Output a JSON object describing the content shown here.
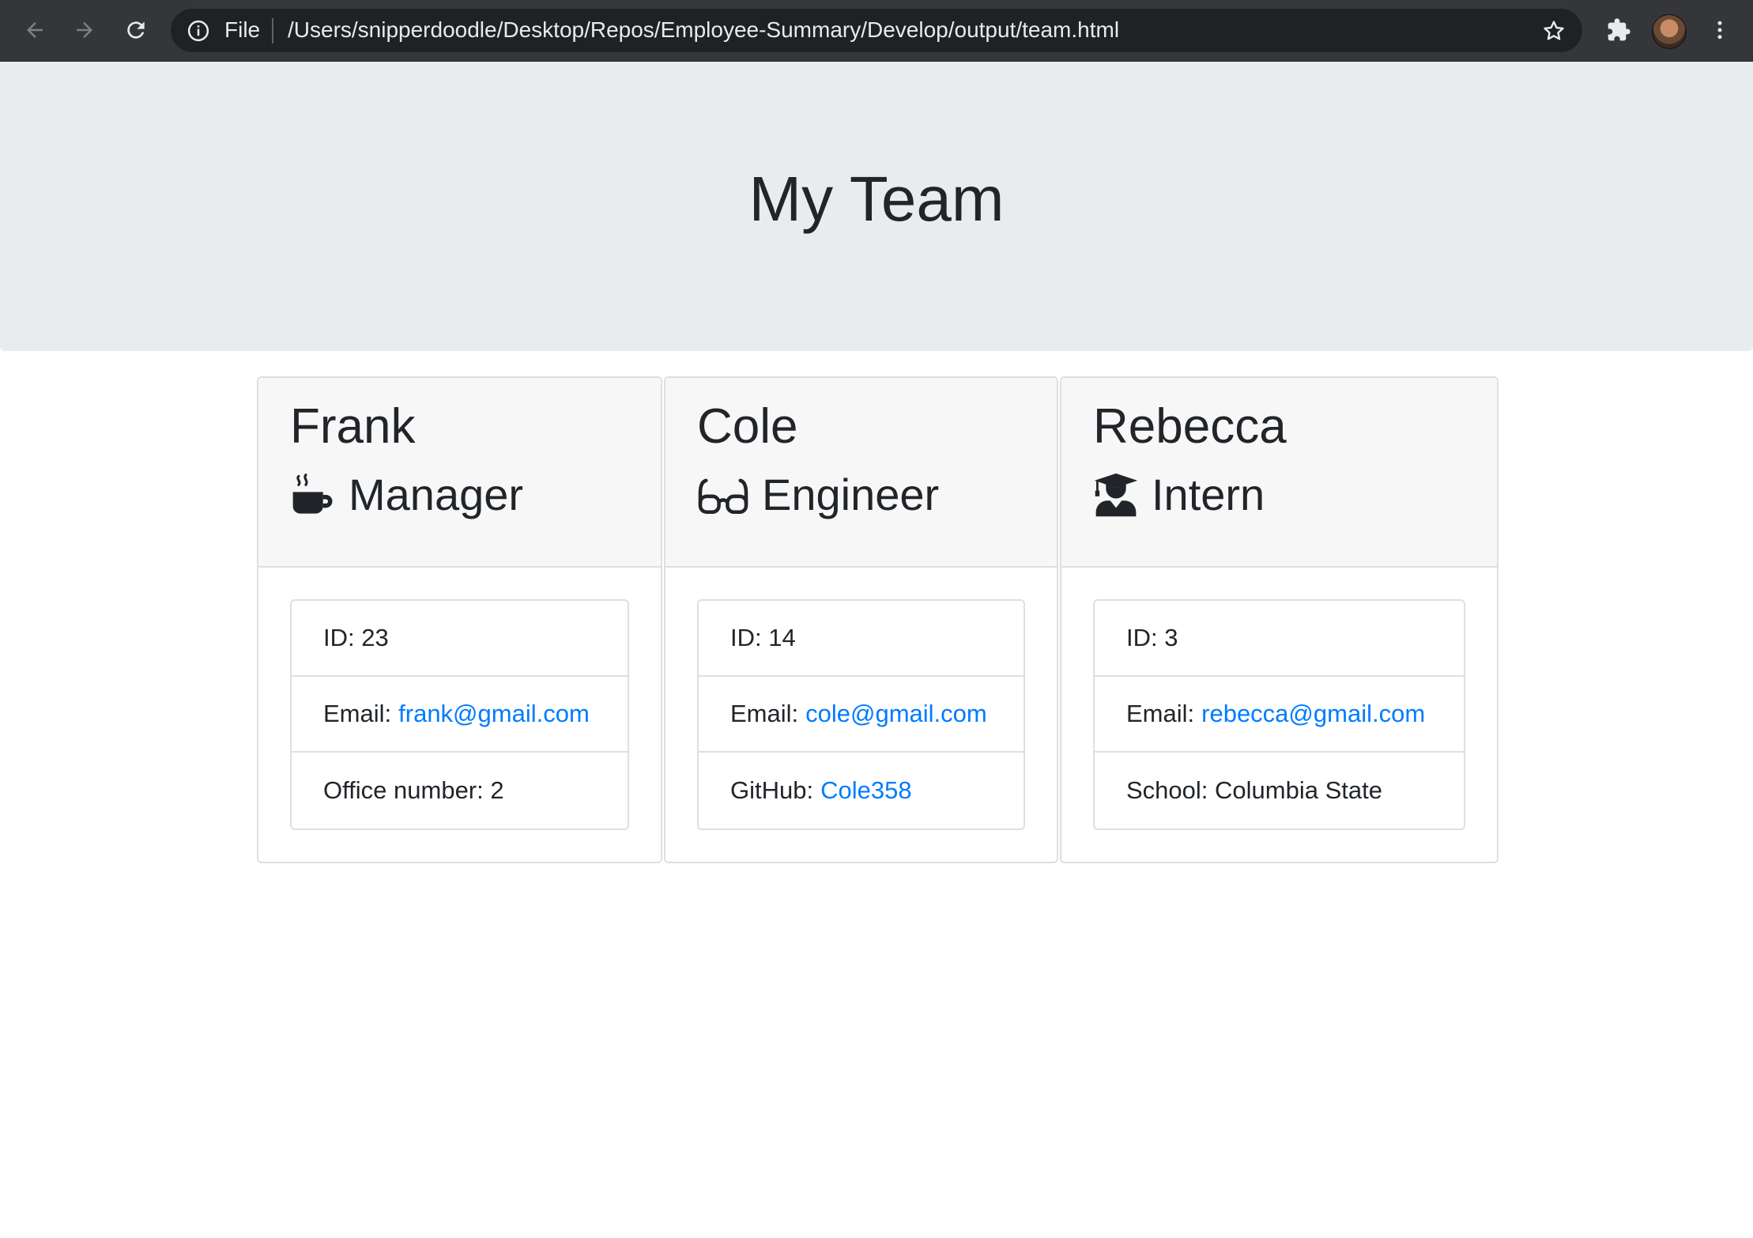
{
  "browser": {
    "scheme_label": "File",
    "url": "/Users/snipperdoodle/Desktop/Repos/Employee-Summary/Develop/output/team.html"
  },
  "page": {
    "title": "My Team"
  },
  "team": [
    {
      "name": "Frank",
      "role": "Manager",
      "role_icon": "mug-hot-icon",
      "details": [
        {
          "label": "ID: 23",
          "link": null
        },
        {
          "label": "Email:",
          "link": "frank@gmail.com"
        },
        {
          "label": "Office number: 2",
          "link": null
        }
      ]
    },
    {
      "name": "Cole",
      "role": "Engineer",
      "role_icon": "glasses-icon",
      "details": [
        {
          "label": "ID: 14",
          "link": null
        },
        {
          "label": "Email:",
          "link": "cole@gmail.com"
        },
        {
          "label": "GitHub:",
          "link": "Cole358"
        }
      ]
    },
    {
      "name": "Rebecca",
      "role": "Intern",
      "role_icon": "user-graduate-icon",
      "details": [
        {
          "label": "ID: 3",
          "link": null
        },
        {
          "label": "Email:",
          "link": "rebecca@gmail.com"
        },
        {
          "label": "School: Columbia State",
          "link": null
        }
      ]
    }
  ],
  "colors": {
    "jumbotron": "#e9ecef",
    "link": "#007bff",
    "text": "#212529",
    "toolbar": "#35363a"
  }
}
